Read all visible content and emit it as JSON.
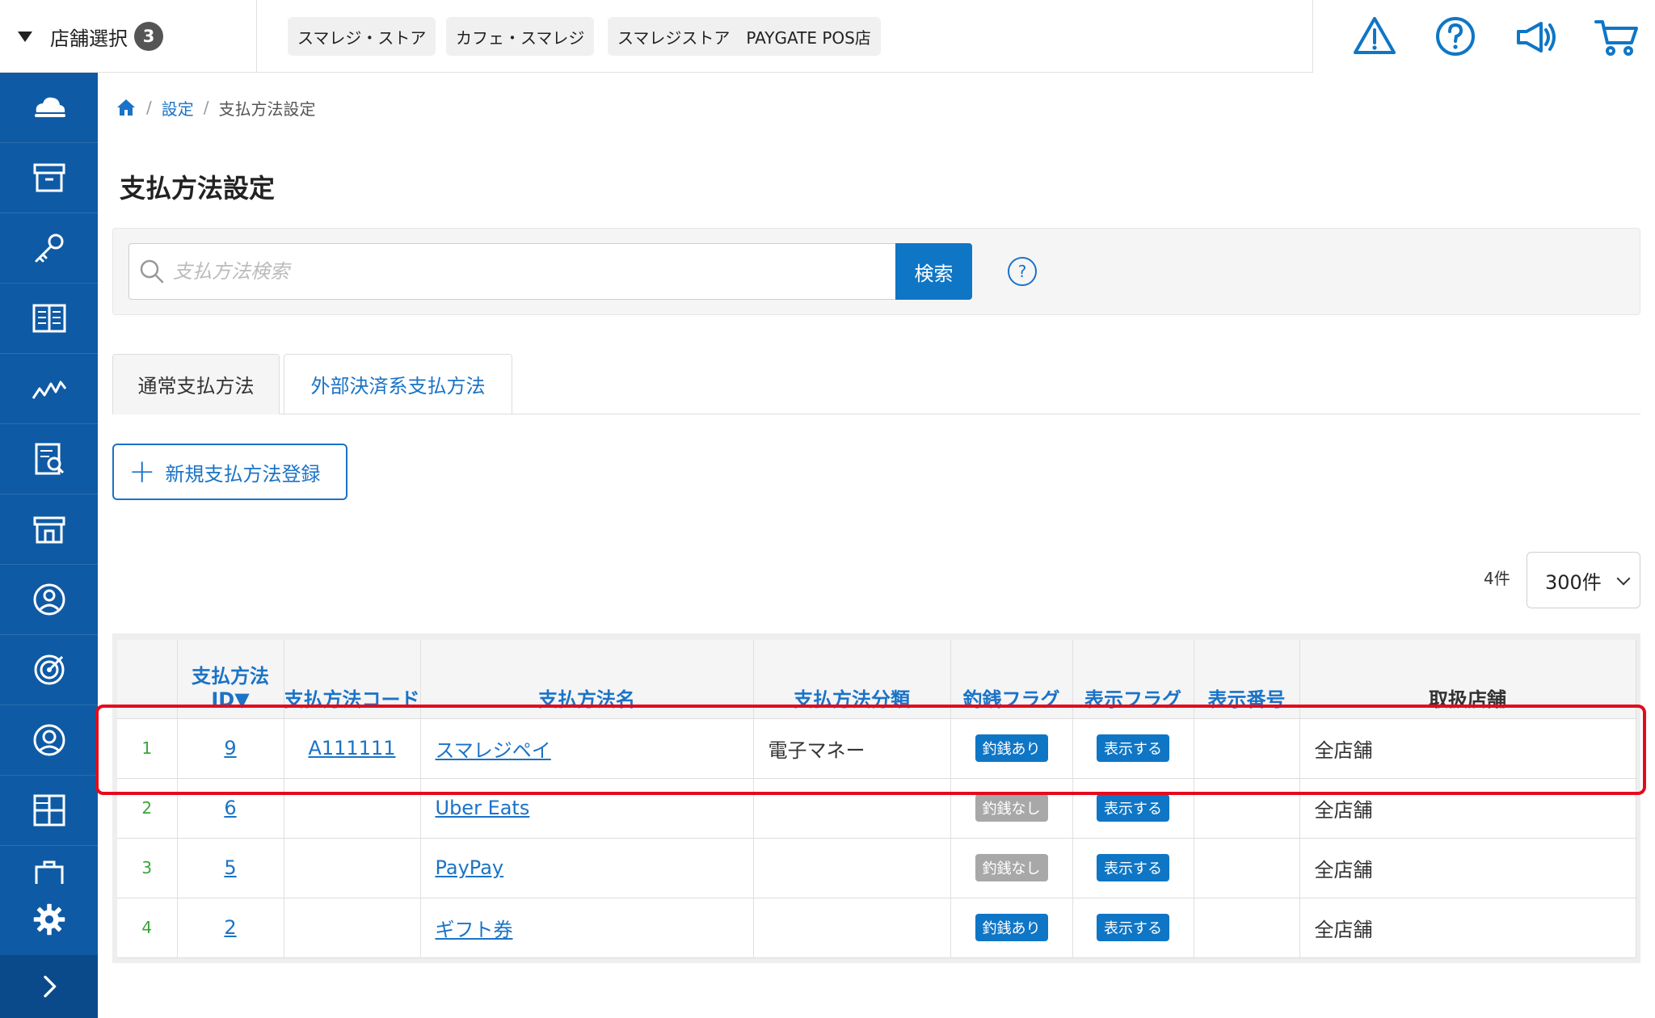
{
  "topbar": {
    "store_select_label": "店舗選択",
    "store_count": "3",
    "store_chips": [
      "スマレジ・ストア",
      "カフェ・スマレジ",
      "スマレジストア　PAYGATE POS店"
    ]
  },
  "breadcrumb": {
    "settings": "設定",
    "current": "支払方法設定"
  },
  "page_title": "支払方法設定",
  "search": {
    "placeholder": "支払方法検索",
    "button_label": "検索",
    "help_label": "?"
  },
  "tabs": [
    {
      "label": "通常支払方法",
      "active": true
    },
    {
      "label": "外部決済系支払方法",
      "active": false
    }
  ],
  "new_button_label": "新規支払方法登録",
  "list": {
    "count": "4件",
    "per_page": "300件"
  },
  "table": {
    "headers": [
      "",
      "支払方法ID▼",
      "支払方法コード",
      "支払方法名",
      "支払方法分類",
      "釣銭フラグ",
      "表示フラグ",
      "表示番号",
      "取扱店舗"
    ],
    "rows": [
      {
        "no": "1",
        "id": "9",
        "code": "A111111",
        "name": "スマレジペイ",
        "category": "電子マネー",
        "change": "釣銭あり",
        "display": "表示する",
        "order": "",
        "stores": "全店舗"
      },
      {
        "no": "2",
        "id": "6",
        "code": "",
        "name": "Uber Eats",
        "category": "",
        "change": "釣銭なし",
        "display": "表示する",
        "order": "",
        "stores": "全店舗"
      },
      {
        "no": "3",
        "id": "5",
        "code": "",
        "name": "PayPay",
        "category": "",
        "change": "釣銭なし",
        "display": "表示する",
        "order": "",
        "stores": "全店舗"
      },
      {
        "no": "4",
        "id": "2",
        "code": "",
        "name": "ギフト券",
        "category": "",
        "change": "釣銭あり",
        "display": "表示する",
        "order": "",
        "stores": "全店舗"
      }
    ]
  },
  "colors": {
    "sidebar": "#0f5aa4",
    "accent": "#0f76c6",
    "highlight": "#e30b1e"
  },
  "icons": [
    "warning-icon",
    "help-icon",
    "megaphone-icon",
    "cart-icon",
    "home-icon",
    "search-icon",
    "gear-icon",
    "chevron-right-icon"
  ]
}
